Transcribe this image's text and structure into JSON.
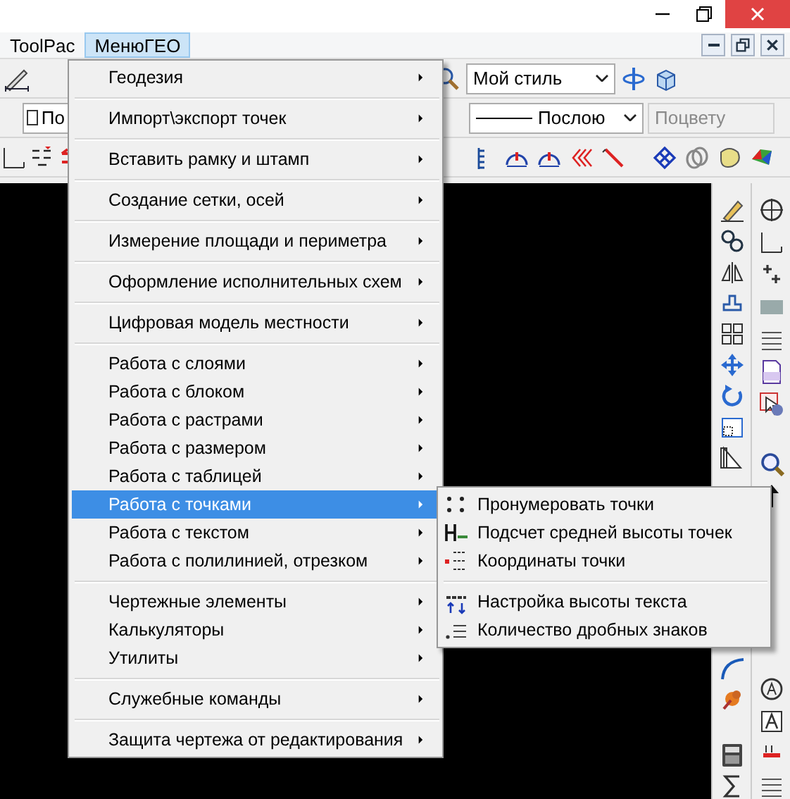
{
  "menubar": [
    {
      "label": "ToolPac",
      "selected": false
    },
    {
      "label": "МенюГЕО",
      "selected": true
    }
  ],
  "toolbar": {
    "layer_combo": {
      "value": "По",
      "checked": false
    },
    "style_combo": {
      "value": "Мой стиль"
    },
    "linetype_combo": {
      "value": "Послою"
    },
    "color_combo": {
      "value": "Поцвету",
      "disabled": true
    }
  },
  "menu": {
    "items": [
      {
        "kind": "item",
        "label": "Геодезия",
        "selected": false,
        "submenu": true
      },
      {
        "kind": "separator"
      },
      {
        "kind": "item",
        "label": "Импорт\\экспорт точек",
        "selected": false,
        "submenu": true
      },
      {
        "kind": "separator"
      },
      {
        "kind": "item",
        "label": "Вставить рамку и штамп",
        "selected": false,
        "submenu": true
      },
      {
        "kind": "separator"
      },
      {
        "kind": "item",
        "label": "Создание сетки, осей",
        "selected": false,
        "submenu": true
      },
      {
        "kind": "separator"
      },
      {
        "kind": "item",
        "label": "Измерение площади и периметра",
        "selected": false,
        "submenu": true
      },
      {
        "kind": "separator"
      },
      {
        "kind": "item",
        "label": "Оформление исполнительных схем",
        "selected": false,
        "submenu": true
      },
      {
        "kind": "separator"
      },
      {
        "kind": "item",
        "label": "Цифровая модель местности",
        "selected": false,
        "submenu": true
      },
      {
        "kind": "separator"
      },
      {
        "kind": "item",
        "label": "Работа с слоями",
        "selected": false,
        "submenu": true
      },
      {
        "kind": "item",
        "label": "Работа с блоком",
        "selected": false,
        "submenu": true
      },
      {
        "kind": "item",
        "label": "Работа с растрами",
        "selected": false,
        "submenu": true
      },
      {
        "kind": "item",
        "label": "Работа с размером",
        "selected": false,
        "submenu": true
      },
      {
        "kind": "item",
        "label": "Работа с таблицей",
        "selected": false,
        "submenu": true
      },
      {
        "kind": "item",
        "label": "Работа с точками",
        "selected": true,
        "submenu": true
      },
      {
        "kind": "item",
        "label": "Работа с текстом",
        "selected": false,
        "submenu": true
      },
      {
        "kind": "item",
        "label": "Работа с полилинией, отрезком",
        "selected": false,
        "submenu": true
      },
      {
        "kind": "separator"
      },
      {
        "kind": "item",
        "label": "Чертежные элементы",
        "selected": false,
        "submenu": true
      },
      {
        "kind": "item",
        "label": "Калькуляторы",
        "selected": false,
        "submenu": true
      },
      {
        "kind": "item",
        "label": "Утилиты",
        "selected": false,
        "submenu": true
      },
      {
        "kind": "separator"
      },
      {
        "kind": "item",
        "label": "Служебные команды",
        "selected": false,
        "submenu": true
      },
      {
        "kind": "separator"
      },
      {
        "kind": "item",
        "label": "Защита чертежа от редактирования",
        "selected": false,
        "submenu": true
      }
    ]
  },
  "submenu": {
    "items": [
      {
        "kind": "item",
        "label": "Пронумеровать точки"
      },
      {
        "kind": "item",
        "label": "Подсчет средней высоты точек"
      },
      {
        "kind": "item",
        "label": "Координаты точки"
      },
      {
        "kind": "separator"
      },
      {
        "kind": "item",
        "label": "Настройка высоты текста"
      },
      {
        "kind": "item",
        "label": "Количество дробных знаков"
      }
    ]
  }
}
